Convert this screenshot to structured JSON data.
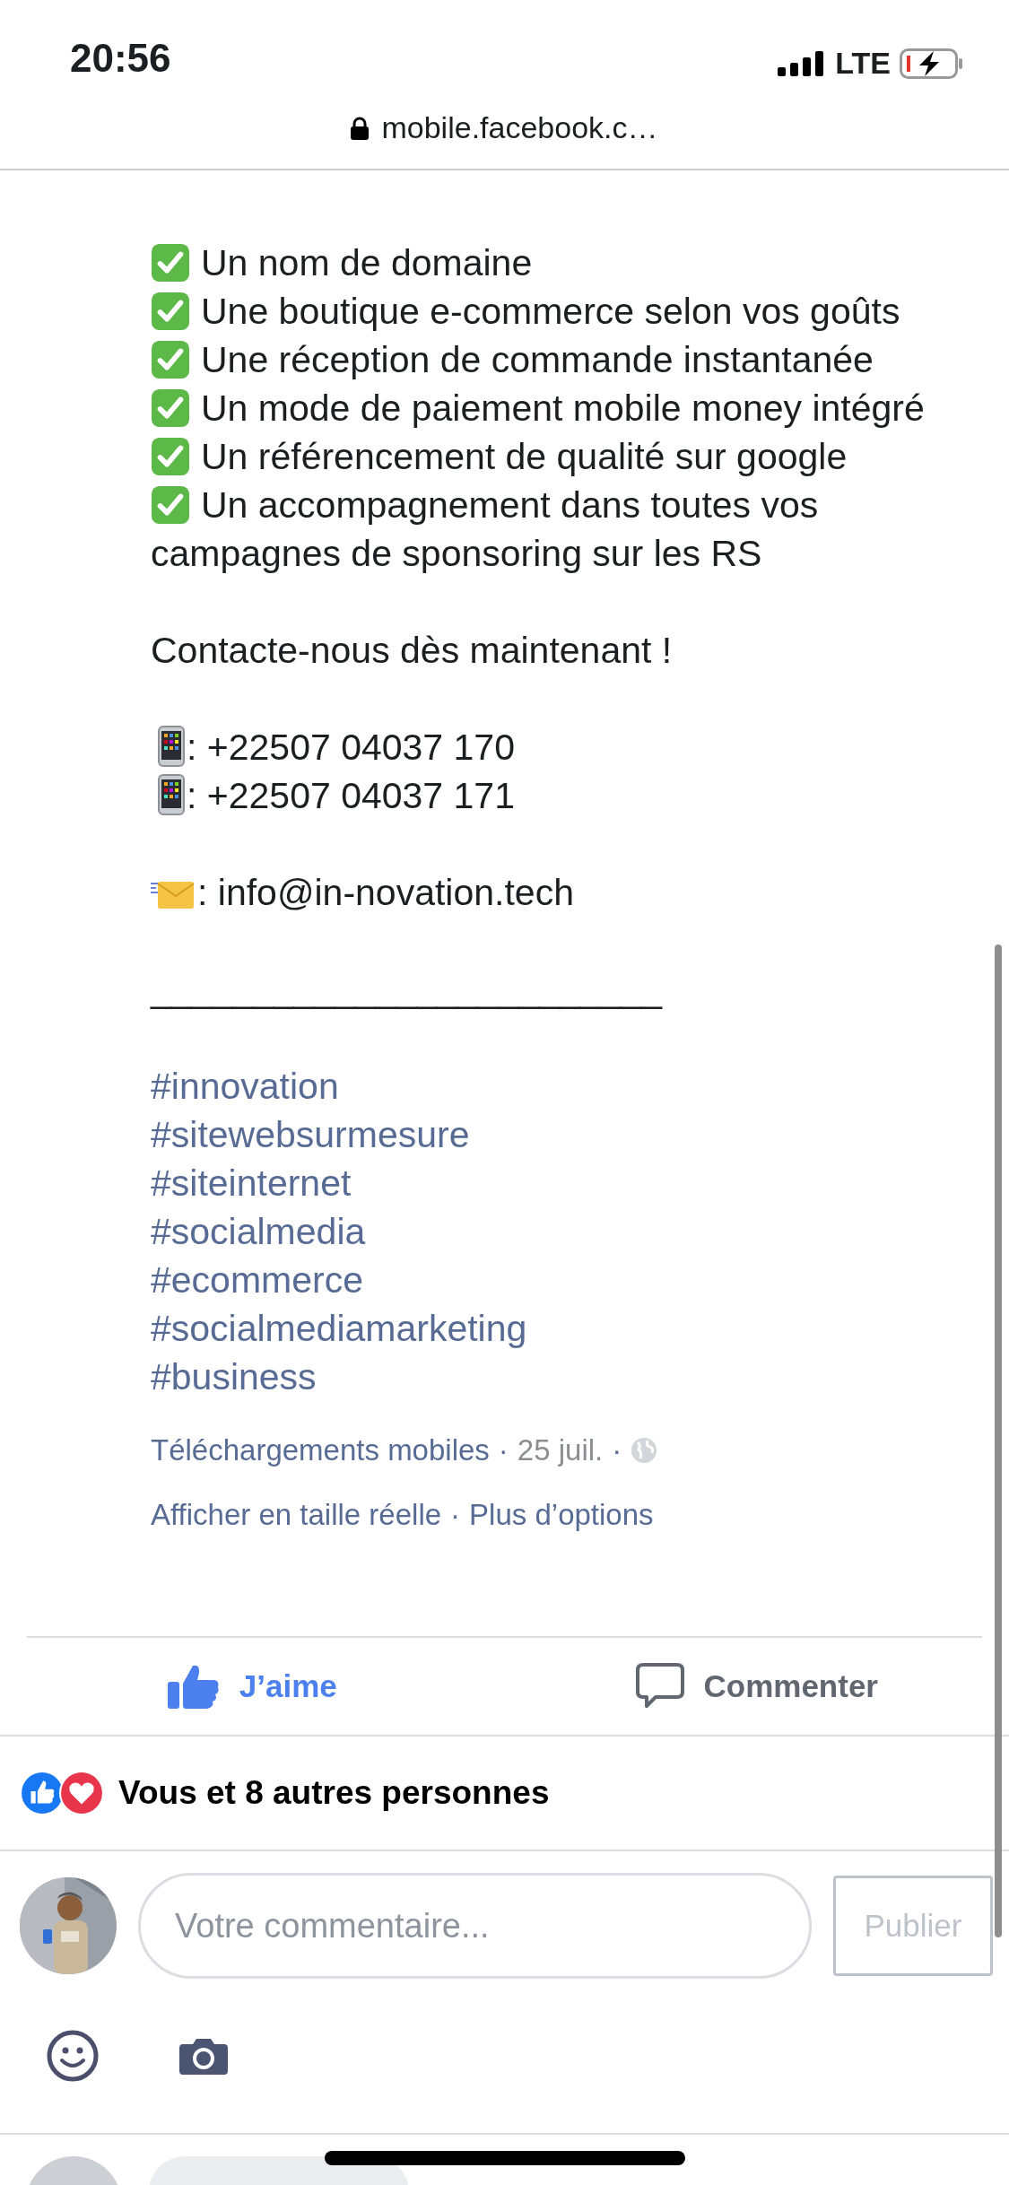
{
  "status_bar": {
    "time": "20:56",
    "network": "LTE",
    "battery": {
      "charging": true
    }
  },
  "address_bar": {
    "url": "mobile.facebook.c…"
  },
  "post": {
    "paragraphs": [
      [
        {
          "kind": "check",
          "text": "Un nom de domaine"
        },
        {
          "kind": "check",
          "text": "Une boutique e-commerce selon vos goûts"
        },
        {
          "kind": "check",
          "text": "Une réception de commande instantanée"
        },
        {
          "kind": "check",
          "text": "Un mode de paiement mobile money intégré"
        },
        {
          "kind": "check",
          "text": "Un référencement de qualité sur google"
        },
        {
          "kind": "check",
          "text": "Un accompagnement dans toutes vos"
        },
        {
          "kind": "text",
          "text": "campagnes de sponsoring sur les RS"
        }
      ],
      [
        {
          "kind": "text",
          "text": "Contacte-nous dès maintenant !"
        }
      ],
      [
        {
          "kind": "phone",
          "text": ": +22507 04037 170"
        },
        {
          "kind": "phone",
          "text": ": +22507 04037 171"
        }
      ],
      [
        {
          "kind": "mail",
          "text": ": info@in-novation.tech"
        }
      ],
      [
        {
          "kind": "text",
          "text": "_________________________"
        }
      ],
      [
        {
          "kind": "hashtag",
          "text": "#innovation"
        },
        {
          "kind": "hashtag",
          "text": "#sitewebsurmesure"
        },
        {
          "kind": "hashtag",
          "text": "#siteinternet"
        },
        {
          "kind": "hashtag",
          "text": "#socialmedia"
        },
        {
          "kind": "hashtag",
          "text": "#ecommerce"
        },
        {
          "kind": "hashtag",
          "text": "#socialmediamarketing"
        },
        {
          "kind": "hashtag",
          "text": "#business"
        }
      ]
    ],
    "meta_lines": [
      [
        {
          "kind": "link",
          "text": "Téléchargements mobiles"
        },
        {
          "kind": "sep",
          "text": "·"
        },
        {
          "kind": "date",
          "text": "25 juil."
        },
        {
          "kind": "sep",
          "text": "·"
        },
        {
          "kind": "globe"
        }
      ],
      [
        {
          "kind": "link",
          "text": "Afficher en taille réelle"
        },
        {
          "kind": "sep",
          "text": "·"
        },
        {
          "kind": "link",
          "text": "Plus d’options"
        }
      ]
    ]
  },
  "actions": [
    {
      "kind": "like",
      "label": "J’aime",
      "selected": true
    },
    {
      "kind": "comment",
      "label": "Commenter",
      "selected": false
    }
  ],
  "reactions": {
    "icons": [
      {
        "kind": "like"
      },
      {
        "kind": "love"
      }
    ],
    "summary": "Vous et 8 autres personnes"
  },
  "composer": {
    "placeholder": "Votre commentaire...",
    "button": {
      "label": "Publier",
      "disabled": true
    },
    "tools": [
      {
        "kind": "emoji"
      },
      {
        "kind": "camera"
      }
    ]
  }
}
